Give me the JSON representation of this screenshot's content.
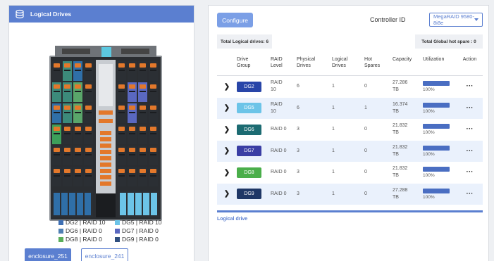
{
  "left": {
    "title": "Logical Drives",
    "legend": [
      [
        {
          "label": "DG2 | RAID 10",
          "color": "#3e6fb3"
        },
        {
          "label": "DG5 | RAID 10",
          "color": "#6cc4e8"
        }
      ],
      [
        {
          "label": "DG6 | RAID 0",
          "color": "#4f7fb3"
        },
        {
          "label": "DG7 | RAID 0",
          "color": "#5a68c0"
        }
      ],
      [
        {
          "label": "DG8 | RAID 0",
          "color": "#5aae5a"
        },
        {
          "label": "DG9 | RAID 0",
          "color": "#2f4f7f"
        }
      ]
    ],
    "enclosures": [
      "enclosure_251",
      "enclosure_241"
    ]
  },
  "right": {
    "configure_label": "Configure",
    "controller_label": "Controller ID",
    "controller_value": "MegaRAID 9580-8i8e",
    "total_logical": "Total Logical drives: 6",
    "total_hotspare": "Total Global hot spare : 0",
    "headers": {
      "drive_group": [
        "Drive",
        "Group"
      ],
      "raid_level": [
        "RAID",
        "Level"
      ],
      "physical": [
        "Physical",
        "Drives"
      ],
      "logical": [
        "Logical",
        "Drives"
      ],
      "hot": [
        "Hot",
        "Spares"
      ],
      "capacity": "Capacity",
      "utilization": "Utilization",
      "action": "Action"
    },
    "rows": [
      {
        "dg": "DG2",
        "color": "#2845a8",
        "raid": [
          "RAID",
          "10"
        ],
        "physical": "6",
        "logical": "1",
        "hot": "0",
        "capacity": [
          "27.286",
          "TB"
        ],
        "util": "100%"
      },
      {
        "dg": "DG5",
        "color": "#6cc4e8",
        "raid": [
          "RAID",
          "10"
        ],
        "physical": "6",
        "logical": "1",
        "hot": "1",
        "capacity": [
          "16.374",
          "TB"
        ],
        "util": "100%"
      },
      {
        "dg": "DG6",
        "color": "#1c6b72",
        "raid": [
          "RAID 0"
        ],
        "physical": "3",
        "logical": "1",
        "hot": "0",
        "capacity": [
          "21.832",
          "TB"
        ],
        "util": "100%"
      },
      {
        "dg": "DG7",
        "color": "#3a3ea4",
        "raid": [
          "RAID 0"
        ],
        "physical": "3",
        "logical": "1",
        "hot": "0",
        "capacity": [
          "21.832",
          "TB"
        ],
        "util": "100%"
      },
      {
        "dg": "DG8",
        "color": "#4aae4a",
        "raid": [
          "RAID 0"
        ],
        "physical": "3",
        "logical": "1",
        "hot": "0",
        "capacity": [
          "21.832",
          "TB"
        ],
        "util": "100%"
      },
      {
        "dg": "DG9",
        "color": "#1f3766",
        "raid": [
          "RAID 0"
        ],
        "physical": "3",
        "logical": "1",
        "hot": "0",
        "capacity": [
          "27.288",
          "TB"
        ],
        "util": "100%"
      }
    ],
    "footer_link": "Logical drive"
  }
}
